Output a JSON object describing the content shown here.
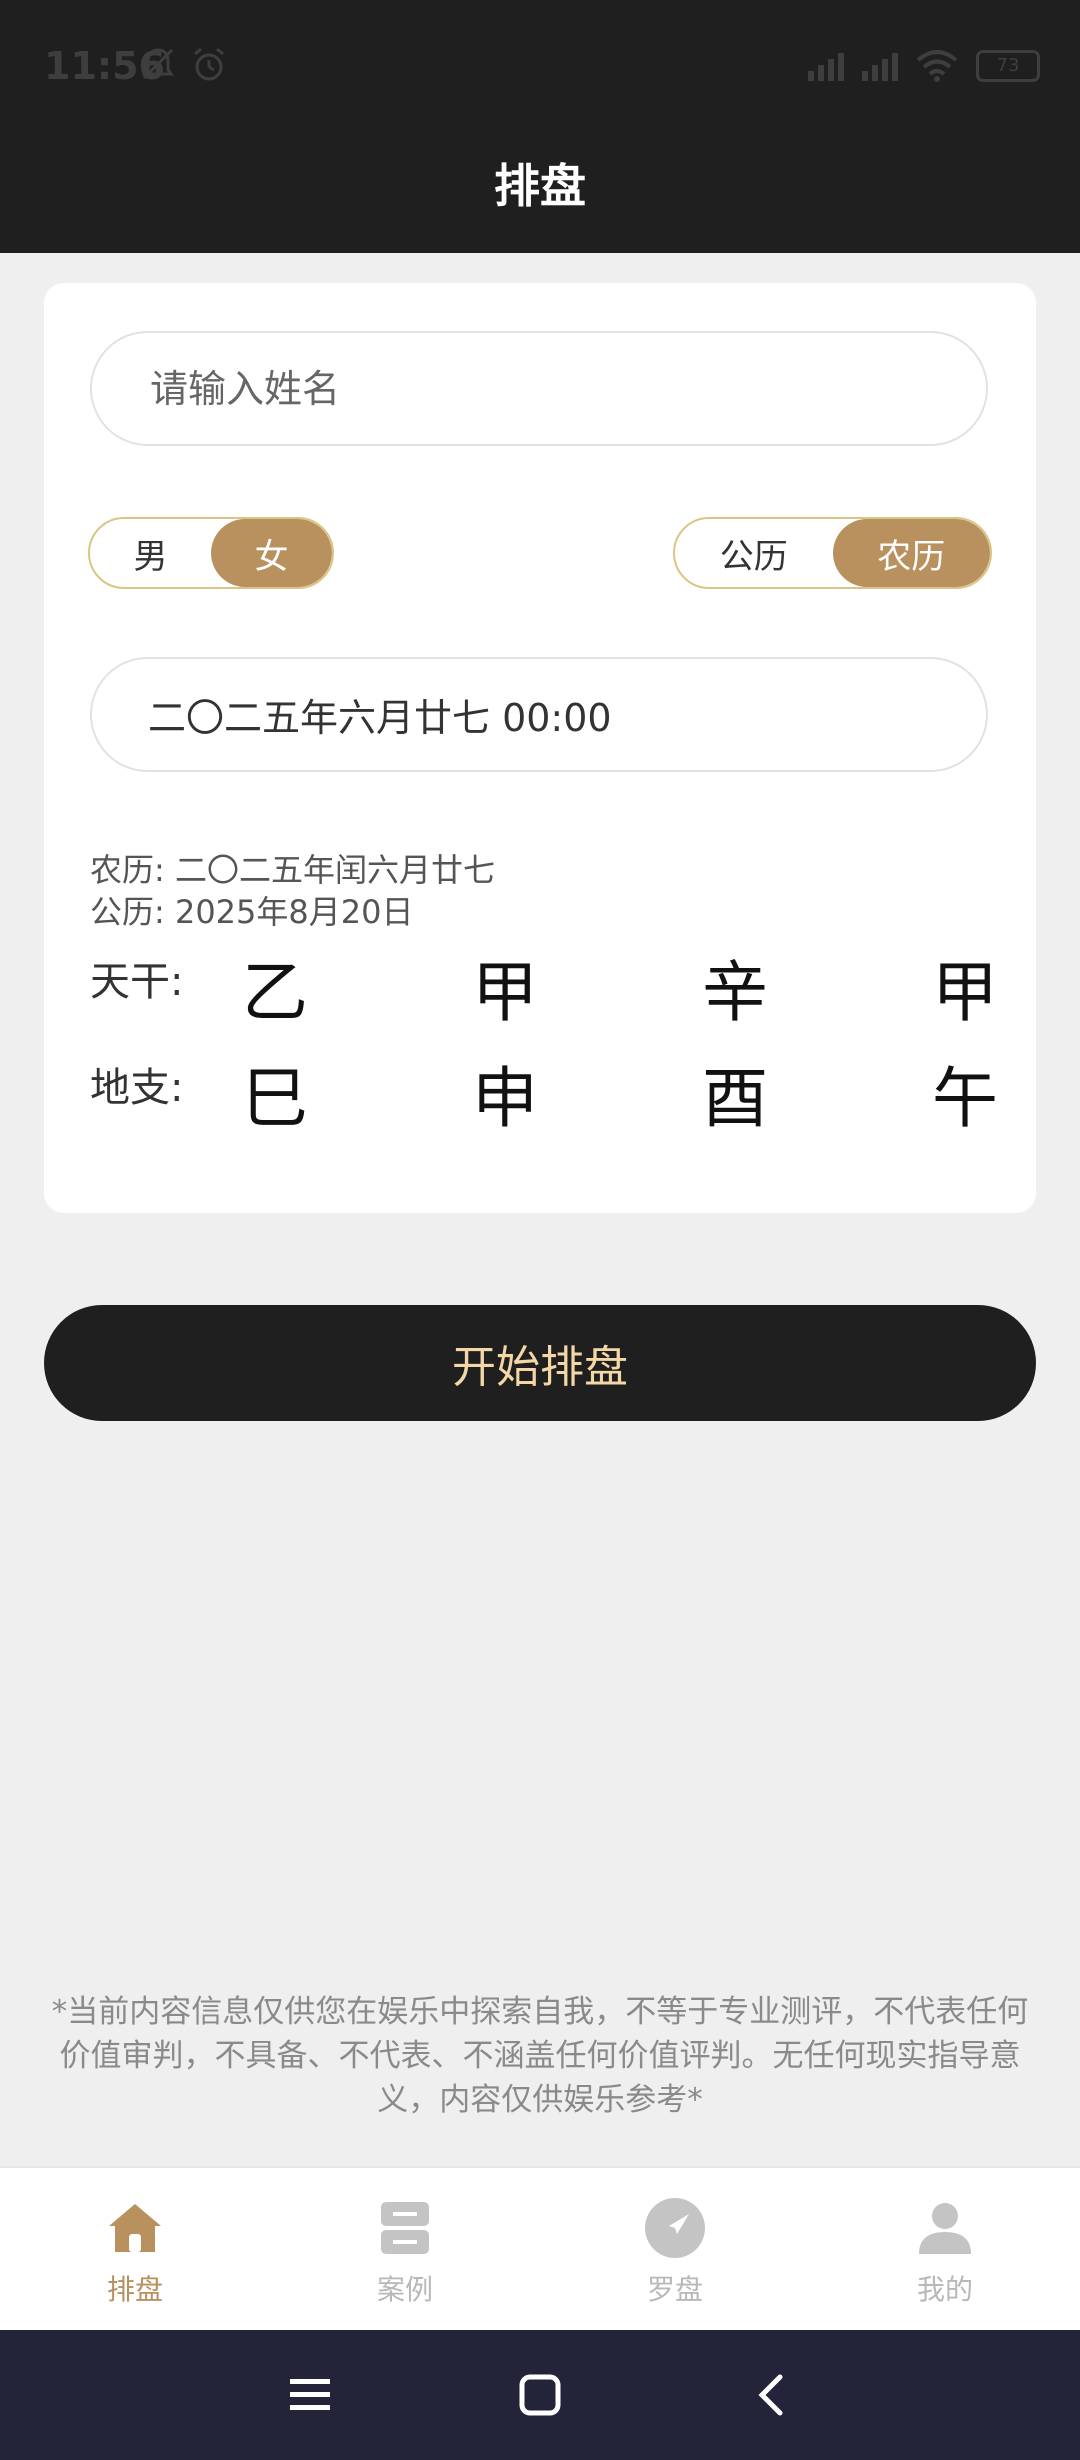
{
  "status": {
    "time": "11:56",
    "battery": "73"
  },
  "header": {
    "title": "排盘"
  },
  "form": {
    "name_placeholder": "请输入姓名",
    "gender": {
      "male": "男",
      "female": "女",
      "selected": "女"
    },
    "calendar": {
      "solar": "公历",
      "lunar": "农历",
      "selected": "农历"
    },
    "datetime_value": "二〇二五年六月廿七 00:00",
    "lunar_line": "农历: 二〇二五年闰六月廿七",
    "solar_line": "公历: 2025年8月20日"
  },
  "ganzhi": {
    "tiangan_label": "天干:",
    "dizhi_label": "地支:",
    "tiangan": [
      "乙",
      "甲",
      "辛",
      "甲"
    ],
    "dizhi": [
      "巳",
      "申",
      "酉",
      "午"
    ]
  },
  "start_button": "开始排盘",
  "disclaimer": "*当前内容信息仅供您在娱乐中探索自我，不等于专业测评，不代表任何价值审判，不具备、不代表、不涵盖任何价值评判。无任何现实指导意义，内容仅供娱乐参考*",
  "tabs": [
    {
      "label": "排盘",
      "icon": "home-icon",
      "active": true
    },
    {
      "label": "案例",
      "icon": "cases-icon",
      "active": false
    },
    {
      "label": "罗盘",
      "icon": "compass-icon",
      "active": false
    },
    {
      "label": "我的",
      "icon": "profile-icon",
      "active": false
    }
  ],
  "colors": {
    "accent": "#b9915f",
    "dark": "#1f1f1f",
    "button_text": "#f4d7a6"
  }
}
